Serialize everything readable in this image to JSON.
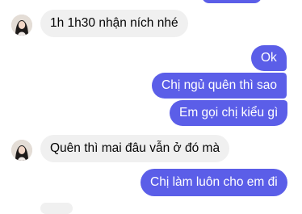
{
  "conversation": {
    "messages": [
      {
        "sender": "them",
        "text": "1h 1h30 nhận ních nhé"
      },
      {
        "sender": "me",
        "text": "Ok"
      },
      {
        "sender": "me",
        "text": "Chị ngủ quên thì sao"
      },
      {
        "sender": "me",
        "text": "Em gọi chị kiểu gì"
      },
      {
        "sender": "them",
        "text": "Quên thì mai đâu vẫn ở đó mà"
      },
      {
        "sender": "me",
        "text": "Chị làm luôn cho em đi"
      }
    ]
  },
  "colors": {
    "outgoing_bubble": "#5b5ee8",
    "incoming_bubble": "#f0f0f0",
    "background": "#ffffff"
  }
}
